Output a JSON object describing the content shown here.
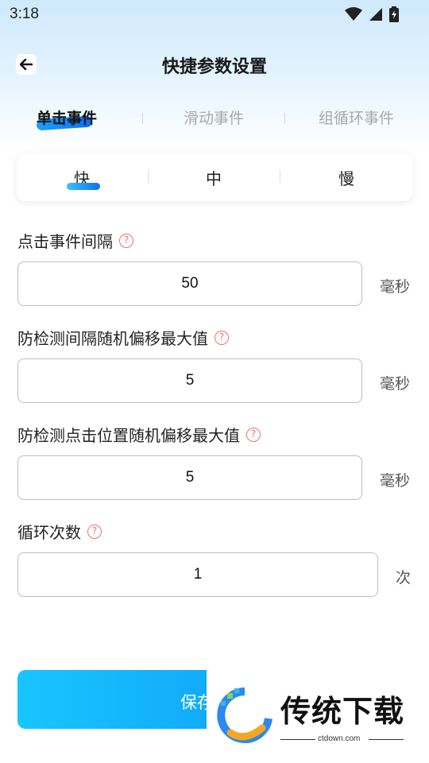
{
  "status": {
    "time": "3:18"
  },
  "header": {
    "title": "快捷参数设置"
  },
  "tabs": [
    {
      "label": "单击事件",
      "active": true
    },
    {
      "label": "滑动事件",
      "active": false
    },
    {
      "label": "组循环事件",
      "active": false
    }
  ],
  "speed": {
    "options": [
      "快",
      "中",
      "慢"
    ],
    "selected": "快"
  },
  "fields": [
    {
      "label": "点击事件间隔",
      "value": "50",
      "unit": "毫秒"
    },
    {
      "label": "防检测间隔随机偏移最大值",
      "value": "5",
      "unit": "毫秒"
    },
    {
      "label": "防检测点击位置随机偏移最大值",
      "value": "5",
      "unit": "毫秒"
    },
    {
      "label": "循环次数",
      "value": "1",
      "unit": "次"
    }
  ],
  "footer": {
    "save_label": "保存"
  },
  "watermark": {
    "brand": "传统下载",
    "url": "ctdown.com"
  },
  "colors": {
    "accent": "#0b8ff5",
    "help": "#f07070"
  }
}
